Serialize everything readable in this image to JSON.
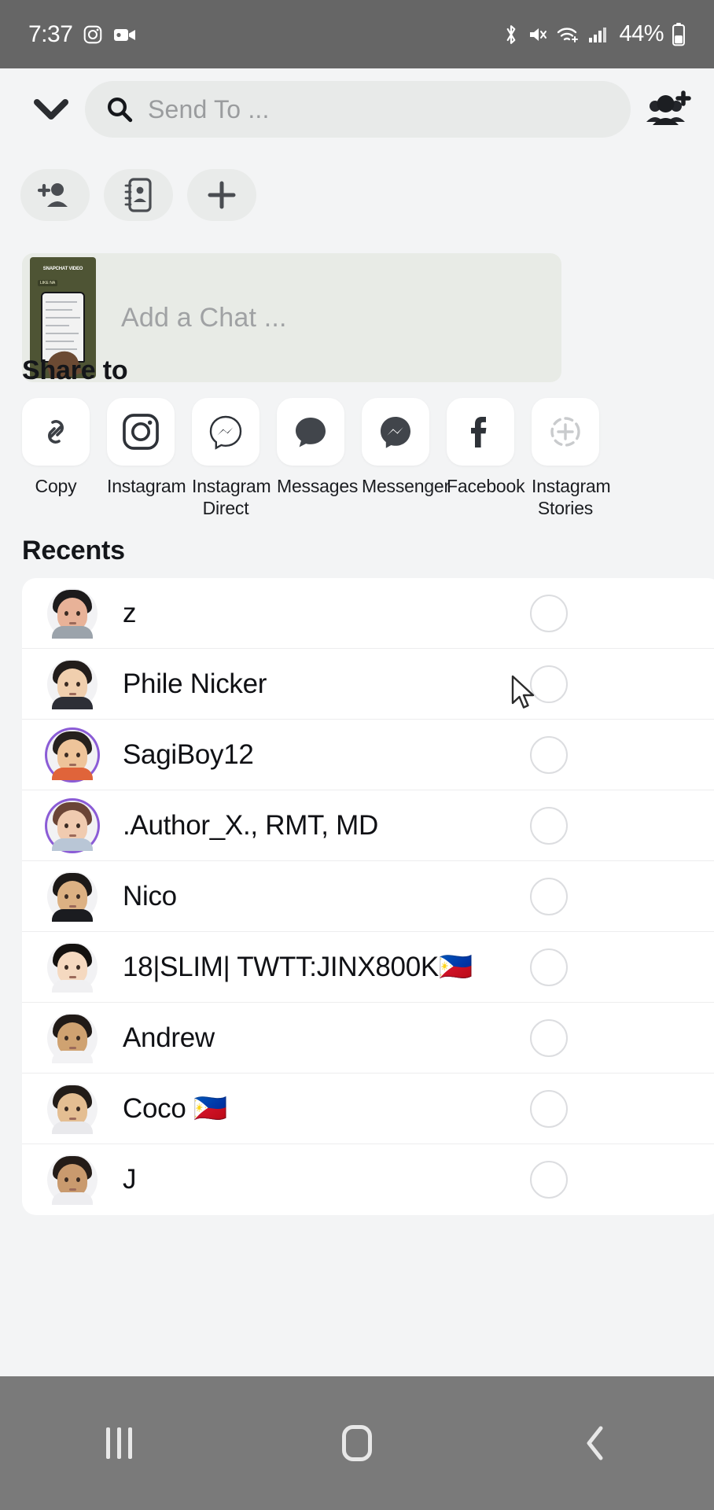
{
  "status_bar": {
    "time": "7:37",
    "battery_percent": "44%",
    "left_icons": [
      "instagram-icon",
      "video-camera-icon"
    ],
    "right_icons": [
      "bluetooth-icon",
      "mute-icon",
      "wifi-icon",
      "cellular-signal-icon",
      "battery-icon"
    ]
  },
  "header": {
    "collapse_icon": "chevron-down-icon",
    "search_placeholder": "Send To ...",
    "search_icon": "search-icon",
    "add_group_icon": "add-group-icon"
  },
  "chips": [
    {
      "name": "add-friend-chip",
      "icon": "add-person-icon"
    },
    {
      "name": "contact-card-chip",
      "icon": "contact-card-icon"
    },
    {
      "name": "new-chip",
      "icon": "plus-icon"
    }
  ],
  "add_chat": {
    "placeholder": "Add a Chat ...",
    "thumbnail_caption": "SNAPCHAT VIDEO",
    "thumbnail_subcaption": "LIKE NA"
  },
  "share": {
    "title": "Share to",
    "items": [
      {
        "label": "Copy",
        "icon": "link-icon"
      },
      {
        "label": "Instagram",
        "icon": "instagram-icon"
      },
      {
        "label": "Instagram Direct",
        "icon": "messenger-outline-icon"
      },
      {
        "label": "Messages",
        "icon": "chat-bubble-icon"
      },
      {
        "label": "Messenger",
        "icon": "messenger-filled-icon"
      },
      {
        "label": "Facebook",
        "icon": "facebook-icon"
      },
      {
        "label": "Instagram Stories",
        "icon": "add-to-story-icon"
      }
    ]
  },
  "recents": {
    "title": "Recents",
    "rows": [
      {
        "name": "z",
        "ring": false,
        "hair": "#1d1b1c",
        "skin": "#e8b298",
        "body": "#9ba3ab"
      },
      {
        "name": "Phile Nicker",
        "ring": false,
        "hair": "#221d1b",
        "skin": "#f0cfae",
        "body": "#2d2f36"
      },
      {
        "name": "SagiBoy12",
        "ring": true,
        "hair": "#26211d",
        "skin": "#eec49a",
        "body": "#e0643a"
      },
      {
        "name": ".Author_X., RMT, MD",
        "ring": true,
        "hair": "#6b4536",
        "skin": "#f0cbb0",
        "body": "#b9c6d6"
      },
      {
        "name": "Nico",
        "ring": false,
        "hair": "#1c1917",
        "skin": "#dcb183",
        "body": "#1b1c20"
      },
      {
        "name": "18|SLIM| TWTT:JINX800K🇵🇭",
        "ring": false,
        "hair": "#14110f",
        "skin": "#f5d9c0",
        "body": "#f0f0f2"
      },
      {
        "name": "Andrew",
        "ring": false,
        "hair": "#201a17",
        "skin": "#cfa271",
        "body": "#f2f2f4"
      },
      {
        "name": "Coco 🇵🇭",
        "ring": false,
        "hair": "#221c18",
        "skin": "#e4be92",
        "body": "#e9e9ec"
      },
      {
        "name": "J",
        "ring": false,
        "hair": "#241c18",
        "skin": "#c99a6e",
        "body": "#ededf0"
      }
    ]
  },
  "nav_bar": {
    "recents_icon": "recent-apps-icon",
    "home_icon": "home-icon",
    "back_icon": "back-chevron-icon"
  },
  "colors": {
    "page_bg": "#f3f4f5",
    "status_bar_bg": "#666666",
    "accent_ring": "#8b5cd6",
    "card_bg": "#ffffff"
  }
}
